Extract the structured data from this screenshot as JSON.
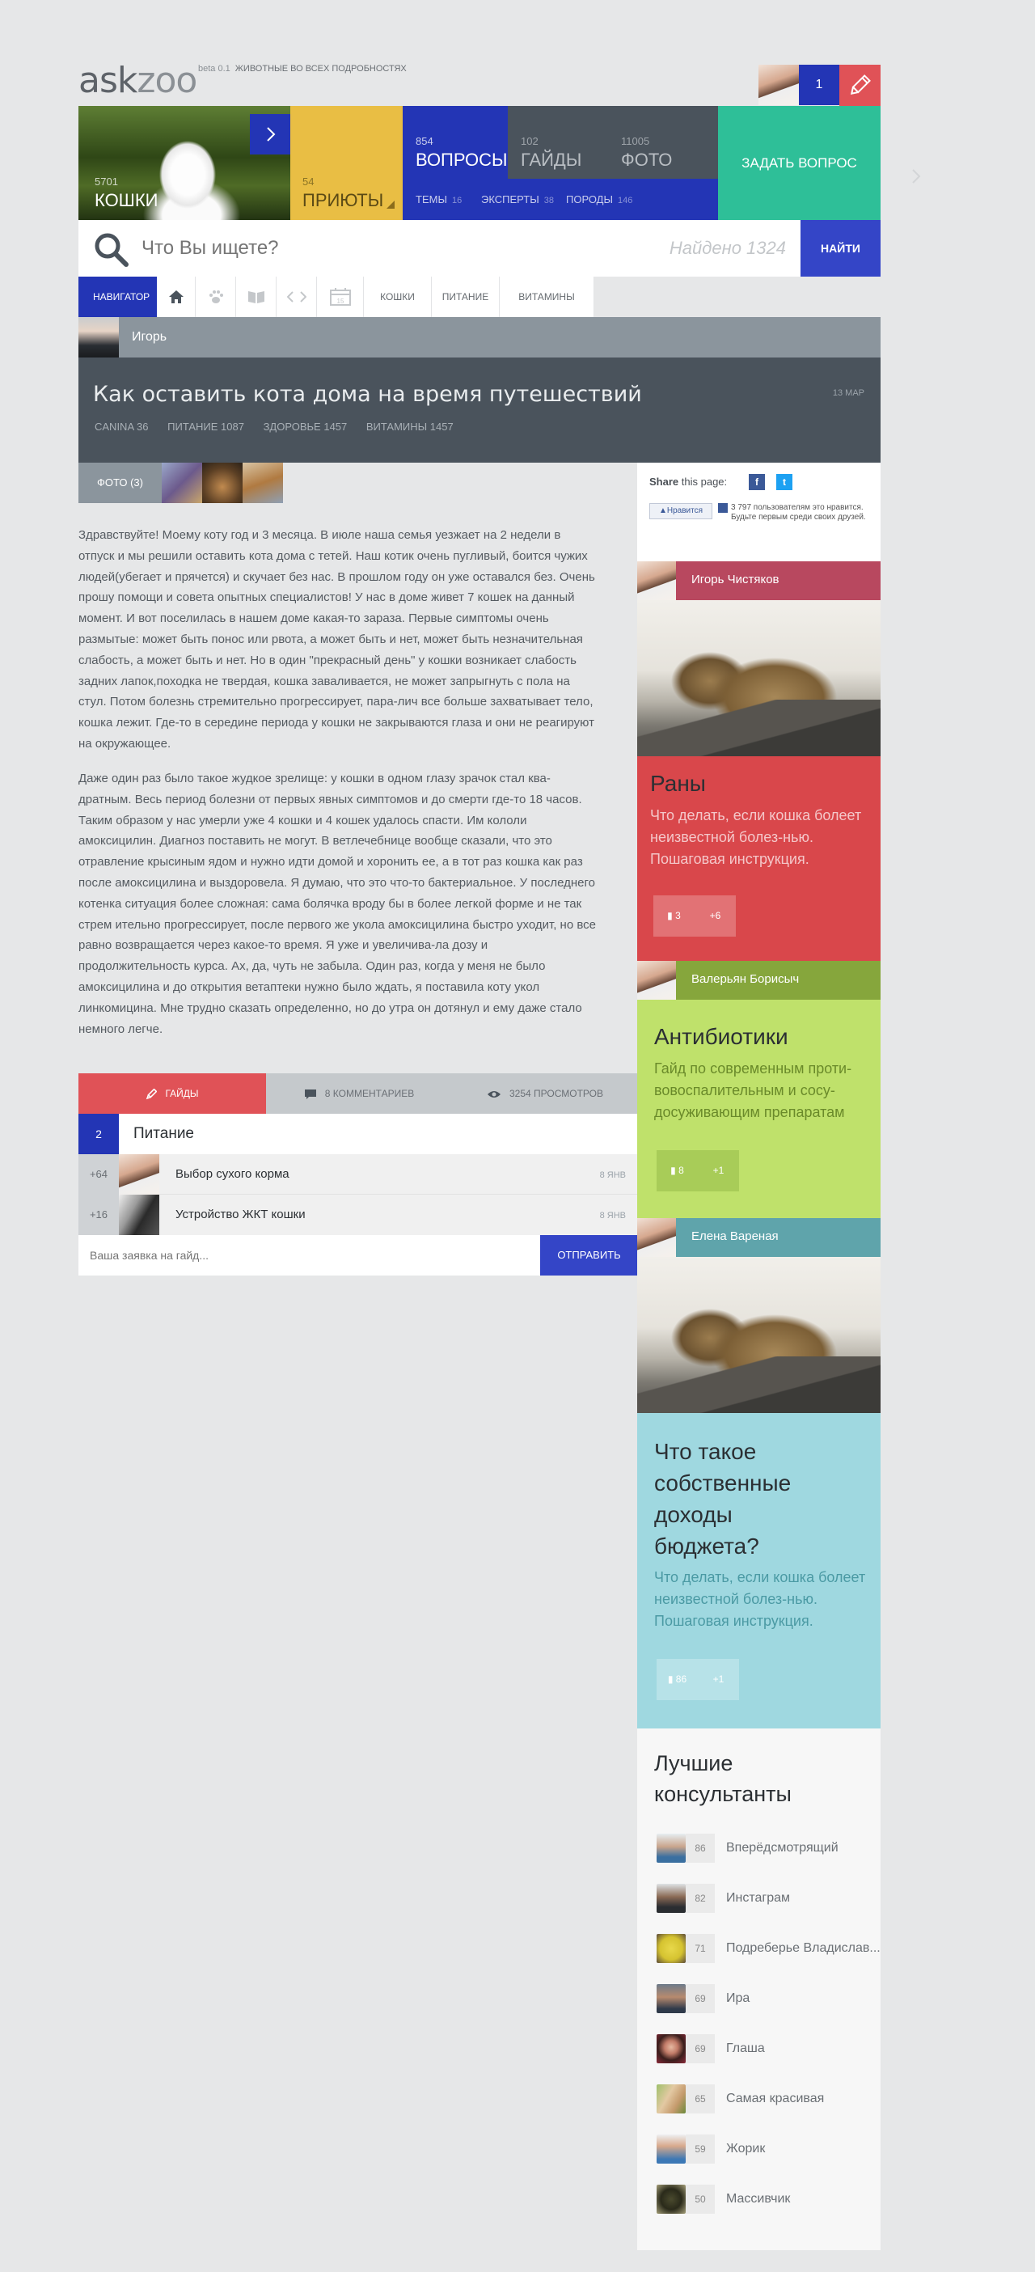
{
  "site": {
    "logo_ask": "ask",
    "logo_zoo": "zoo",
    "beta": "beta 0.1",
    "tagline": "ЖИВОТНЫЕ ВО ВСЕХ ПОДРОБНОСТЯХ",
    "notifications": "1"
  },
  "tiles": {
    "cats": {
      "num": "5701",
      "label": "КОШКИ"
    },
    "shelters": {
      "num": "54",
      "label": "ПРИЮТЫ"
    },
    "questions": {
      "num": "854",
      "label": "ВОПРОСЫ"
    },
    "guides": {
      "num": "102",
      "label": "ГАЙДЫ"
    },
    "photos": {
      "num": "11005",
      "label": "ФОТО"
    },
    "ask": {
      "label": "ЗАДАТЬ ВОПРОС"
    },
    "stats": [
      {
        "label": "ТЕМЫ",
        "num": "16"
      },
      {
        "label": "ЭКСПЕРТЫ",
        "num": "38"
      },
      {
        "label": "ПОРОДЫ",
        "num": "146"
      }
    ]
  },
  "search": {
    "placeholder": "Что Вы ищете?",
    "found": "Найдено 1324",
    "button": "НАЙТИ"
  },
  "nav": {
    "navigator": "НАВИГАТОР",
    "calendar_day": "15",
    "tabs": [
      "КОШКИ",
      "ПИТАНИЕ",
      "ВИТАМИНЫ"
    ]
  },
  "article": {
    "author": "Игорь",
    "title": "Как оставить кота дома на время путешествий",
    "date": "13 МАР",
    "tags": [
      {
        "label": "CANINA",
        "num": "36"
      },
      {
        "label": "ПИТАНИЕ",
        "num": "1087"
      },
      {
        "label": "ЗДОРОВЬЕ",
        "num": "1457"
      },
      {
        "label": "ВИТАМИНЫ",
        "num": "1457"
      }
    ],
    "photos_label": "ФОТО (3)",
    "paragraphs": [
      "Здравствуйте! Моему коту год и 3 месяца. В июле наша семья уезжает на 2 недели в отпуск и мы решили оставить кота дома с тетей. Наш котик очень пугливый, боится чужих людей(убегает и прячется) и скучает без нас. В прошлом году он уже оставался без. Очень прошу помощи и совета опытных специалистов! У нас в доме живет 7 кошек на данный момент. И вот поселилась в нашем доме какая-то зараза. Первые симптомы очень размытые: может быть понос или рвота, а может быть и нет, может быть незначительная слабость, а может быть и нет. Но в один \"прекрасный день\" у кошки возникает слабость задних лапок,походка не твердая, кошка заваливается, не может запрыгнуть с пола на стул. Потом болезнь стремительно прогрессирует, пара-лич все больше захватывает тело, кошка лежит. Где-то в середине периода у кошки не закрываются глаза и они не реагируют на окружающее.",
      "Даже один раз было такое жудкое зрелище: у кошки в одном глазу зрачок стал ква-дратным. Весь период болезни от первых явных симптомов и до смерти где-то 18 часов. Таким образом у нас умерли уже 4 кошки и 4 кошек удалось спасти. Им кололи амоксицилин. Диагноз поставить не могут. В ветлечебнице вообще сказали, что это отравление крысиным ядом и нужно идти домой и хоронить ее, а в тот раз кошка как раз после амоксицилина и выздоровела. Я думаю, что это что-то бактериальное. У последнего котенка ситуация более сложная: сама болячка вроду бы в более легкой форме и не так стрем  ительно прогрессирует, после первого же укола амоксицилина быстро уходит, но все равно возвращается через какое-то время. Я уже и увеличива-ла дозу и продолжительность курса. Ах, да, чуть не забыла. Один раз, когда у меня не было амоксицилина и до открытия ветаптеки нужно было ждать, я поставила коту укол линкомицина. Мне трудно сказать определенно, но до утра он дотянул и ему даже стало немного легче."
    ],
    "bar": {
      "guides": "ГАЙДЫ",
      "comments": "8 КОММЕНТАРИЕВ",
      "views": "3254 ПРОСМОТРОВ"
    },
    "guide_count": "2",
    "guide_title": "Питание",
    "guides_list": [
      {
        "score": "+64",
        "title": "Выбор сухого корма",
        "date": "8 ЯНВ"
      },
      {
        "score": "+16",
        "title": "Устройство ЖКТ кошки",
        "date": "8 ЯНВ"
      }
    ],
    "request_placeholder": "Ваша заявка на гайд...",
    "send": "ОТПРАВИТЬ"
  },
  "sidebar": {
    "share_label": "Share",
    "share_rest": "this page:",
    "like_btn": "Нравится",
    "like_text": "3 797 пользователям это нравится. Будьте первым среди своих друзей.",
    "cards": [
      {
        "user": "Игорь Чистяков",
        "title": "Раны",
        "desc": "Что делать, если кошка болеет неизвестной болез-нью. Пошаговая инструкция.",
        "comments": "3",
        "plus": "+6"
      },
      {
        "user": "Валерьян Борисыч",
        "title": "Антибиотики",
        "desc": "Гайд по современным проти-вовоспалительным и сосу-досуживающим препаратам",
        "comments": "8",
        "plus": "+1"
      },
      {
        "user": "Елена Вареная",
        "title": "Что такое собственные доходы бюджета?",
        "desc": "Что делать, если кошка болеет неизвестной болез-нью. Пошаговая инструкция.",
        "comments": "86",
        "plus": "+1"
      }
    ],
    "consultants_title": "Лучшие консультанты",
    "consultants": [
      {
        "score": "86",
        "name": "Вперёдсмотрящий"
      },
      {
        "score": "82",
        "name": "Инстаграм"
      },
      {
        "score": "71",
        "name": "Подреберье Владислав..."
      },
      {
        "score": "69",
        "name": "Ира"
      },
      {
        "score": "69",
        "name": "Глаша"
      },
      {
        "score": "65",
        "name": "Самая красивая"
      },
      {
        "score": "59",
        "name": "Жорик"
      },
      {
        "score": "50",
        "name": "Массивчик"
      }
    ]
  },
  "colors": {
    "blue": "#2335b5",
    "yellow": "#e9be44",
    "teal": "#2ebf98",
    "slate": "#4a535c",
    "red": "#e05257",
    "card_red": "#d9474b",
    "green": "#bfe16b",
    "green_head": "#86a63c",
    "cyan": "#9fd8e0",
    "cyan_head": "#5fa4ab",
    "pink_head": "#b8485f"
  }
}
